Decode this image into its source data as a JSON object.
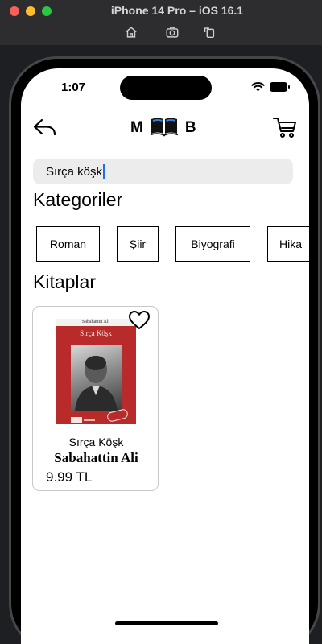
{
  "simulator": {
    "title": "iPhone 14 Pro – iOS 16.1",
    "buttons": [
      "home-icon",
      "screenshot-icon",
      "rotate-icon"
    ]
  },
  "status_bar": {
    "time": "1:07",
    "icons": [
      "wifi-icon",
      "battery-icon"
    ]
  },
  "header": {
    "logo_left": "M",
    "logo_right": "B",
    "icons": [
      "back-arrow-icon",
      "book-icon",
      "cart-icon"
    ]
  },
  "search": {
    "value": "Sırça köşk"
  },
  "categories": {
    "title": "Kategoriler",
    "items": [
      {
        "label": "Roman"
      },
      {
        "label": "Şiir"
      },
      {
        "label": "Biyografi"
      },
      {
        "label": "Hika"
      }
    ]
  },
  "books": {
    "title": "Kitaplar",
    "items": [
      {
        "cover_author": "Sabahattin Ali",
        "cover_title": "Sırça Köşk",
        "title": "Sırça Köşk",
        "author": "Sabahattin Ali",
        "price": "9.99 TL",
        "favorite_icon": "heart-outline-icon"
      }
    ]
  },
  "colors": {
    "cover_red": "#b92b2a",
    "search_bg": "#ececec",
    "caret_blue": "#1f6feb"
  }
}
